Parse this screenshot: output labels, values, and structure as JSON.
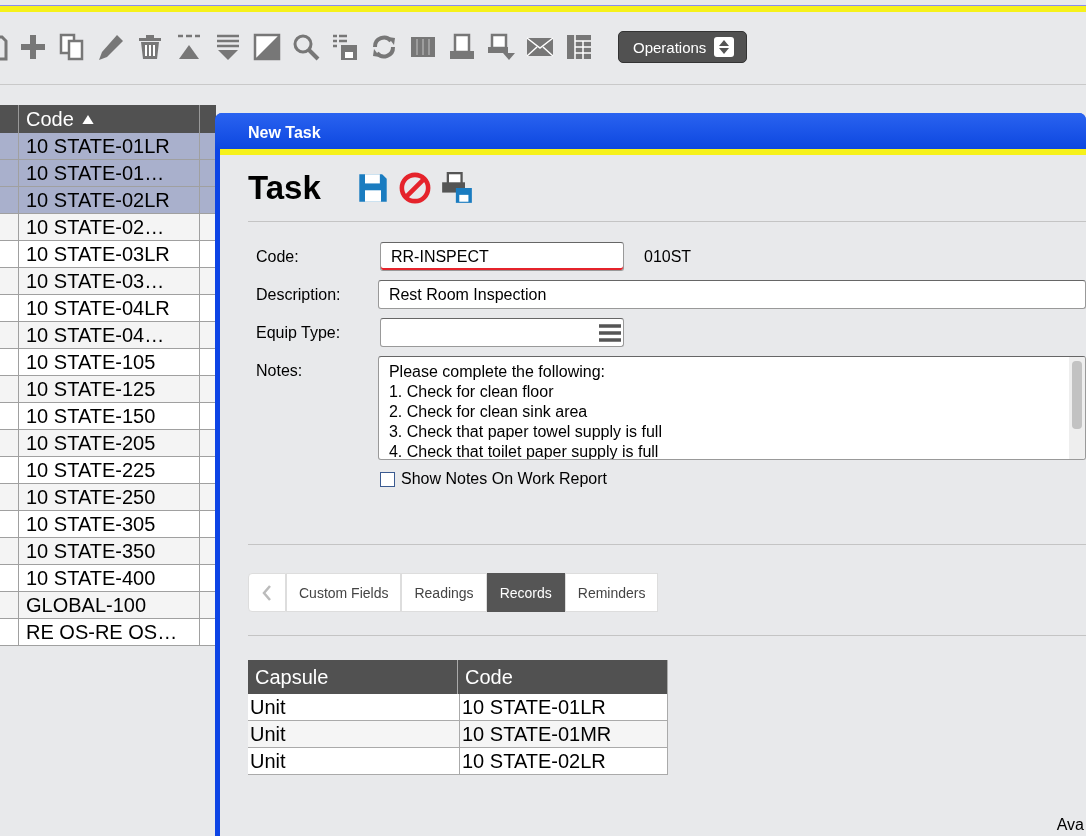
{
  "toolbar": {
    "operations_button": "Operations"
  },
  "table": {
    "columns": [
      {
        "label": "Code",
        "sorted": true
      }
    ],
    "rows": [
      {
        "code": "10 STATE-01LR",
        "selected": true
      },
      {
        "code": "10 STATE-01…",
        "selected": true
      },
      {
        "code": "10 STATE-02LR",
        "selected": true
      },
      {
        "code": "10 STATE-02…",
        "selected": false
      },
      {
        "code": "10 STATE-03LR",
        "selected": false
      },
      {
        "code": "10 STATE-03…",
        "selected": false
      },
      {
        "code": "10 STATE-04LR",
        "selected": false
      },
      {
        "code": "10 STATE-04…",
        "selected": false
      },
      {
        "code": "10 STATE-105",
        "selected": false
      },
      {
        "code": "10 STATE-125",
        "selected": false
      },
      {
        "code": "10 STATE-150",
        "selected": false
      },
      {
        "code": "10 STATE-205",
        "selected": false
      },
      {
        "code": "10 STATE-225",
        "selected": false
      },
      {
        "code": "10 STATE-250",
        "selected": false
      },
      {
        "code": "10 STATE-305",
        "selected": false
      },
      {
        "code": "10 STATE-350",
        "selected": false
      },
      {
        "code": "10 STATE-400",
        "selected": false
      },
      {
        "code": "GLOBAL-100",
        "selected": false
      },
      {
        "code": "RE OS-RE OS…",
        "selected": false
      }
    ]
  },
  "dialog": {
    "title": "New Task",
    "heading": "Task",
    "fields": [
      {
        "kind": "text",
        "label": "Code:",
        "value": "RR-INSPECT",
        "required": true,
        "note": "010ST"
      },
      {
        "kind": "text",
        "label": "Description:",
        "value": "Rest Room Inspection",
        "required": false
      },
      {
        "kind": "lookup",
        "label": "Equip Type:",
        "required": false
      },
      {
        "kind": "notes",
        "label": "Notes:",
        "required": false,
        "lines": [
          "Please complete the following:",
          "1. Check for clean floor",
          "2. Check for clean sink area",
          "3. Check that paper towel supply is full",
          "4. Check that toilet paper supply is full"
        ]
      }
    ],
    "checkbox": {
      "label": "Show Notes On Work Report",
      "checked": false
    },
    "tabs": [
      {
        "label": "Custom Fields",
        "selected": false
      },
      {
        "label": "Readings",
        "selected": false
      },
      {
        "label": "Records",
        "selected": true
      },
      {
        "label": "Reminders",
        "selected": false
      }
    ],
    "records": {
      "columns": [
        "Capsule",
        "Code"
      ],
      "rows": [
        [
          "Unit",
          "10 STATE-01LR"
        ],
        [
          "Unit",
          "10 STATE-01MR"
        ],
        [
          "Unit",
          "10 STATE-02LR"
        ]
      ]
    },
    "footer_text": "Ava"
  }
}
